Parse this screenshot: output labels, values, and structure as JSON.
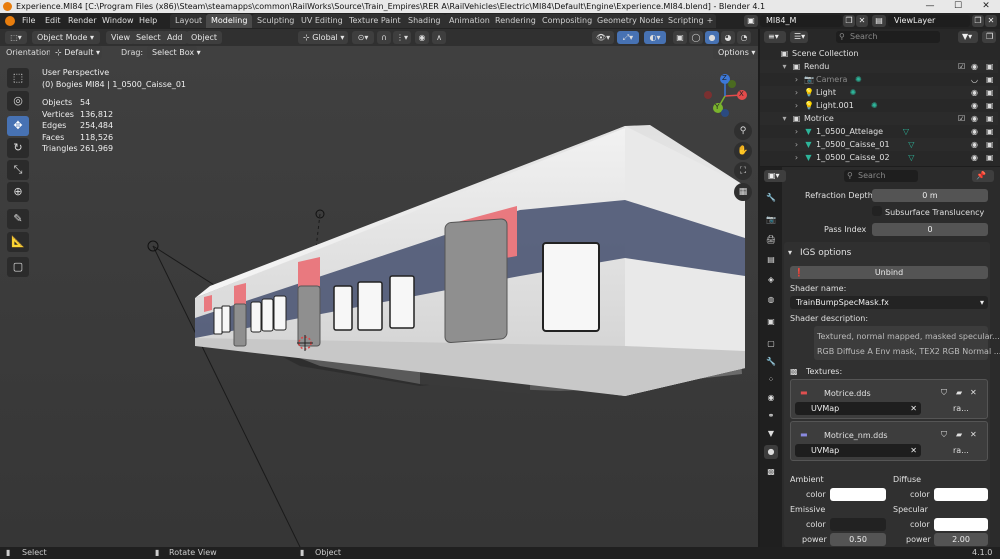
{
  "window": {
    "title": "Experience.MI84 [C:\\Program Files (x86)\\Steam\\steamapps\\common\\RailWorks\\Source\\Train_Empires\\RER A\\RailVehicles\\Electric\\MI84\\Default\\Engine\\Experience.MI84.blend] - Blender 4.1",
    "min_glyph": "—",
    "max_glyph": "☐",
    "close_glyph": "✕"
  },
  "menu": [
    "File",
    "Edit",
    "Render",
    "Window",
    "Help"
  ],
  "workspaces": {
    "tabs": [
      "Layout",
      "Modeling",
      "Sculpting",
      "UV Editing",
      "Texture Paint",
      "Shading",
      "Animation",
      "Rendering",
      "Compositing",
      "Geometry Nodes",
      "Scripting"
    ],
    "active": "Modeling",
    "add": "+"
  },
  "scene": {
    "name": "MI84_M",
    "view_layer": "ViewLayer"
  },
  "viewport_header": {
    "mode": "Object Mode",
    "view": "View",
    "select": "Select",
    "add": "Add",
    "object": "Object",
    "transform_orientation": "Global",
    "options": "Options"
  },
  "viewport_sub": {
    "orientation_label": "Orientation:",
    "orientation_value": "Default",
    "drag_label": "Drag:",
    "drag_value": "Select Box"
  },
  "viewport_info": {
    "perspective": "User Perspective",
    "object_path": "(0) Bogies MI84 | 1_0500_Caisse_01",
    "stats": [
      {
        "label": "Objects",
        "value": "54"
      },
      {
        "label": "Vertices",
        "value": "136,812"
      },
      {
        "label": "Edges",
        "value": "254,484"
      },
      {
        "label": "Faces",
        "value": "118,526"
      },
      {
        "label": "Triangles",
        "value": "261,969"
      }
    ]
  },
  "gizmo": {
    "x": "X",
    "y": "Y",
    "z": "Z"
  },
  "outliner": {
    "search_placeholder": "Search",
    "rows": [
      {
        "label": "Scene Collection",
        "indent": 0,
        "icon": "collection-icon",
        "expand": ""
      },
      {
        "label": "Rendu",
        "indent": 1,
        "icon": "collection-icon",
        "expand": "▾"
      },
      {
        "label": "Camera",
        "indent": 2,
        "icon": "camera-icon",
        "expand": "›",
        "dim": true
      },
      {
        "label": "Light",
        "indent": 2,
        "icon": "light-icon",
        "expand": "›"
      },
      {
        "label": "Light.001",
        "indent": 2,
        "icon": "light-icon",
        "expand": "›"
      },
      {
        "label": "Motrice",
        "indent": 1,
        "icon": "collection-icon",
        "expand": "▾"
      },
      {
        "label": "1_0500_Attelage",
        "indent": 2,
        "icon": "mesh-icon",
        "expand": "›"
      },
      {
        "label": "1_0500_Caisse_01",
        "indent": 2,
        "icon": "mesh-icon",
        "expand": "›"
      },
      {
        "label": "1_0500_Caisse_02",
        "indent": 2,
        "icon": "mesh-icon",
        "expand": "›"
      }
    ]
  },
  "properties": {
    "search_placeholder": "Search",
    "refraction_depth_label": "Refraction Depth",
    "refraction_depth_value": "0 m",
    "subsurface_label": "Subsurface Translucency",
    "pass_index_label": "Pass Index",
    "pass_index_value": "0",
    "igs_panel": "IGS options",
    "unbind_button": "Unbind",
    "shader_name_label": "Shader name:",
    "shader_name_value": "TrainBumpSpecMask.fx",
    "shader_desc_label": "Shader description:",
    "shader_desc_line1": "Textured, normal mapped, masked specular...",
    "shader_desc_line2": "RGB Diffuse A Env mask, TEX2 RGB Normal ...",
    "textures_label": "Textures:",
    "textures": [
      {
        "name": "Motrice.dds",
        "uvmap": "UVMap",
        "extra": "ra..."
      },
      {
        "name": "Motrice_nm.dds",
        "uvmap": "UVMap",
        "extra": "ra..."
      }
    ],
    "ambient_label": "Ambient",
    "diffuse_label": "Diffuse",
    "color_label": "color",
    "emissive_label": "Emissive",
    "specular_label": "Specular",
    "power_label": "power",
    "emissive_power": "0.50",
    "specular_power": "2.00",
    "ambient_color": "#ffffff",
    "diffuse_color": "#ffffff",
    "emissive_color": "#222222",
    "specular_color": "#ffffff"
  },
  "statusbar": {
    "select": "Select",
    "rotate_view": "Rotate View",
    "object": "Object",
    "version": "4.1.0"
  },
  "colors": {
    "accent_blue": "#4772b3",
    "train_red": "#e9797f",
    "train_stripe": "#4b5573",
    "mesh_green": "#2db59a"
  }
}
